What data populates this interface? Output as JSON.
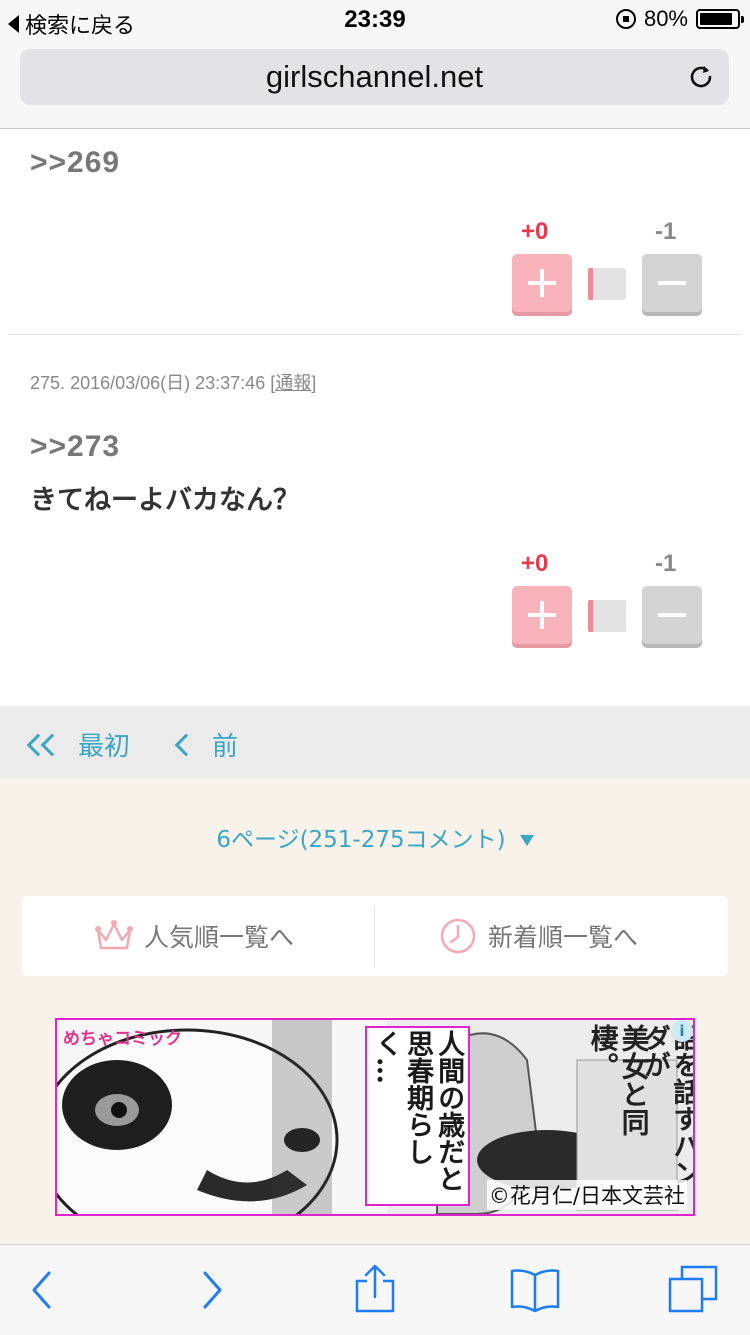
{
  "status_bar": {
    "back_label": "検索に戻る",
    "time": "23:39",
    "battery": "80%"
  },
  "url_bar": {
    "domain": "girlschannel.net"
  },
  "comments": [
    {
      "quote": ">>269",
      "body": "",
      "plus": "+0",
      "minus": "-1"
    },
    {
      "number": "275.",
      "datetime": "2016/03/06(日) 23:37:46",
      "report_link": "通報",
      "quote": ">>273",
      "body": "きてねーよバカなん？",
      "plus": "+0",
      "minus": "-1"
    }
  ],
  "pager": {
    "first": "最初",
    "prev": "前"
  },
  "page_select": "6ページ(251-275コメント)",
  "sort": {
    "popular": "人気順一覧へ",
    "newest": "新着順一覧へ"
  },
  "ad": {
    "logo_a": "めちゃ",
    "logo_b": "コミック",
    "text1": "人間の歳だと思春期らしく…",
    "text2": "美女と同棲。",
    "text3": "語を話すパンダが",
    "copyright": "©花月仁/日本文芸社",
    "info": "i"
  },
  "colors": {
    "accent": "#3aa6c4",
    "plus": "#e8394a",
    "plus_button": "#f8b4ba",
    "minus_button": "#d4d4d4",
    "footer_bg": "#f8f2ea"
  }
}
